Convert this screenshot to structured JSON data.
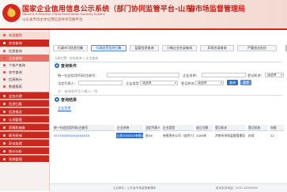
{
  "header": {
    "title": "国家企业信用信息公示系统",
    "title_tag": "（部门协同监管平台-山东）",
    "title_en": "National Enterprise Credit Information Publicity System",
    "subtitle": "山东省市场主体信用信息共享交换平台",
    "department": "省市场监督管理局"
  },
  "sidebar": {
    "items": [
      {
        "label": "欢迎使用",
        "style": "top"
      },
      {
        "label": "综合查询",
        "style": "section"
      },
      {
        "label": "信息查询",
        "style": "sub"
      },
      {
        "label": "企业查询",
        "style": "active"
      },
      {
        "label": "个体户查询",
        "style": "sub"
      },
      {
        "label": "农专查询",
        "style": "sub"
      },
      {
        "label": "信息统计",
        "style": "sub"
      },
      {
        "label": "数据报表",
        "style": "sub"
      },
      {
        "label": "业务办理",
        "style": "plain"
      },
      {
        "label": "信息归集",
        "style": "plain"
      },
      {
        "label": "信息推送",
        "style": "plain"
      },
      {
        "label": "认领管理",
        "style": "plain"
      },
      {
        "label": "双随机抽查",
        "style": "plain"
      },
      {
        "label": "联合惩戒",
        "style": "plain"
      },
      {
        "label": "异议处理",
        "style": "plain"
      },
      {
        "label": "统计分析",
        "style": "plain"
      },
      {
        "label": "系统管理",
        "style": "plain"
      }
    ]
  },
  "tabs": [
    {
      "label": "行政许可信息归集"
    },
    {
      "label": "行政处罚信息归集"
    },
    {
      "label": "监管信息查询"
    },
    {
      "label": "小微企业名录查询"
    },
    {
      "label": "异常名录查询"
    },
    {
      "label": "严重违法失信"
    }
  ],
  "breadcrumb": "当前位置：综合查询 > 企业查询",
  "search": {
    "section_title": "查询条件",
    "fields": {
      "credit_code_label": "统一社会信用代码/注册号：",
      "credit_code_placeholder": "",
      "name_label": "企业名称：",
      "name_placeholder": "",
      "region_label": "登记机关：",
      "region_value": "请选择",
      "legal_label": "法定代表人：",
      "legal_value": "",
      "type_label": "企业类型",
      "type_value": "请选择",
      "status_label": "登记状态",
      "status_value": "请选择"
    },
    "query_button": "查询",
    "reset_button": "重置",
    "hint": "注：查询条件至少输入一项"
  },
  "results": {
    "section_title": "查询结果",
    "tab_label": "企业信息",
    "columns": [
      "统一社会信用代码/注册号",
      "企业名称",
      "法定代表人",
      "企业类型",
      "成立日期",
      "登记机关",
      "登记状态",
      "年报"
    ],
    "rows": [
      [
        "91370000XXXXXXXXXX",
        "山东XXXXXX有限公司",
        "张XX",
        "有限责任公司（自然人投资）",
        "2008年",
        "济南市市场监督管理局",
        "存续",
        "12"
      ]
    ]
  },
  "footer": {
    "left": "主办单位：山东省市场监督管理局",
    "right": "技术支持电话：0531-XXXXXXX"
  }
}
